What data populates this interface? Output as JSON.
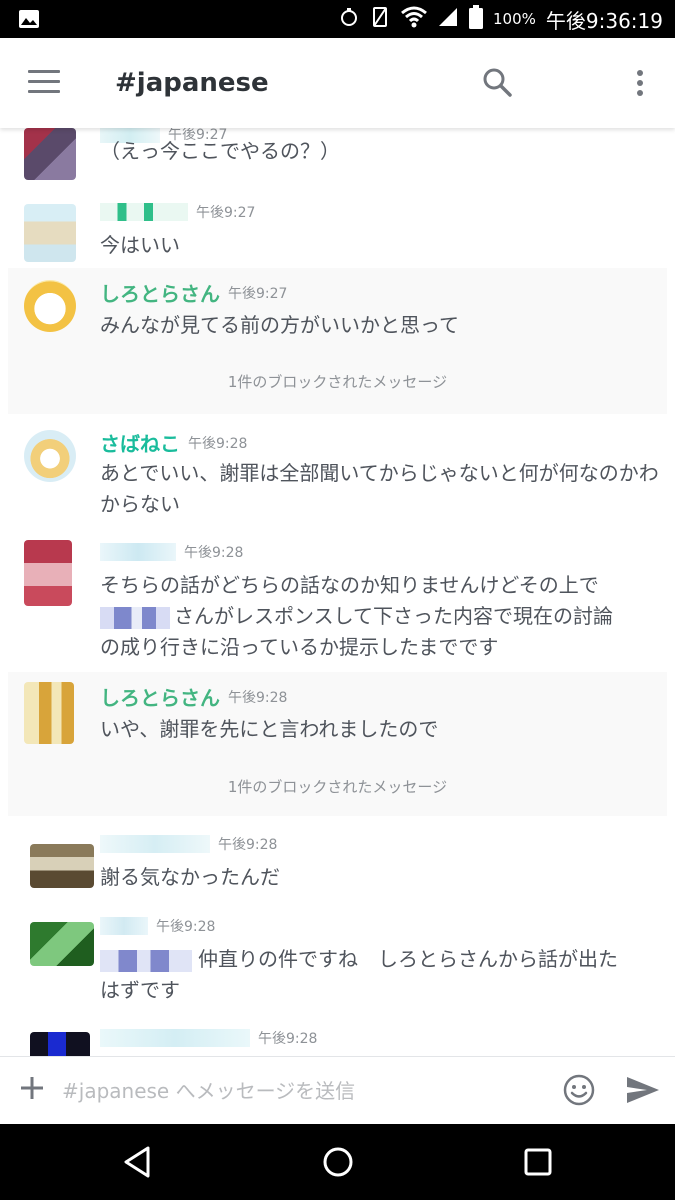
{
  "status_bar": {
    "battery_pct": "100%",
    "time": "午後9:36:19"
  },
  "header": {
    "channel": "#japanese"
  },
  "messages": [
    {
      "timestamp": "午後9:27",
      "text": "（えっ今ここでやるの？）"
    },
    {
      "timestamp": "午後9:27",
      "text": "今はいい"
    },
    {
      "username": "しろとらさん",
      "username_color": "#43b581",
      "timestamp": "午後9:27",
      "text": "みんなが見てる前の方がいいかと思って"
    },
    {
      "username": "さばねこ",
      "username_color": "#1abc9c",
      "timestamp": "午後9:28",
      "text": "あとでいい、謝罪は全部聞いてからじゃないと何が何なのかわからない"
    },
    {
      "timestamp": "午後9:28",
      "text_line1": "そちらの話がどちらの話なのか知りませんけどその上で",
      "text_line2": "さんがレスポンスして下さった内容で現在の討論",
      "text_line3": "の成り行きに沿っているか提示したまでです"
    },
    {
      "username": "しろとらさん",
      "username_color": "#43b581",
      "timestamp": "午後9:28",
      "text": "いや、謝罪を先にと言われましたので"
    },
    {
      "timestamp": "午後9:28",
      "text": "謝る気なかったんだ"
    },
    {
      "timestamp": "午後9:28",
      "text_line1": "仲直りの件ですね　しろとらさんから話が出た",
      "text_line2": "はずです"
    },
    {
      "timestamp": "午後9:28"
    }
  ],
  "blocked_notices": [
    "1件のブロックされたメッセージ",
    "1件のブロックされたメッセージ"
  ],
  "composer": {
    "placeholder": "#japanese へメッセージを送信"
  },
  "icons": {
    "menu": "hamburger-icon",
    "search": "search-icon",
    "more": "more-vertical-icon",
    "plus": "plus-icon",
    "emoji": "emoji-icon",
    "send": "send-icon"
  }
}
